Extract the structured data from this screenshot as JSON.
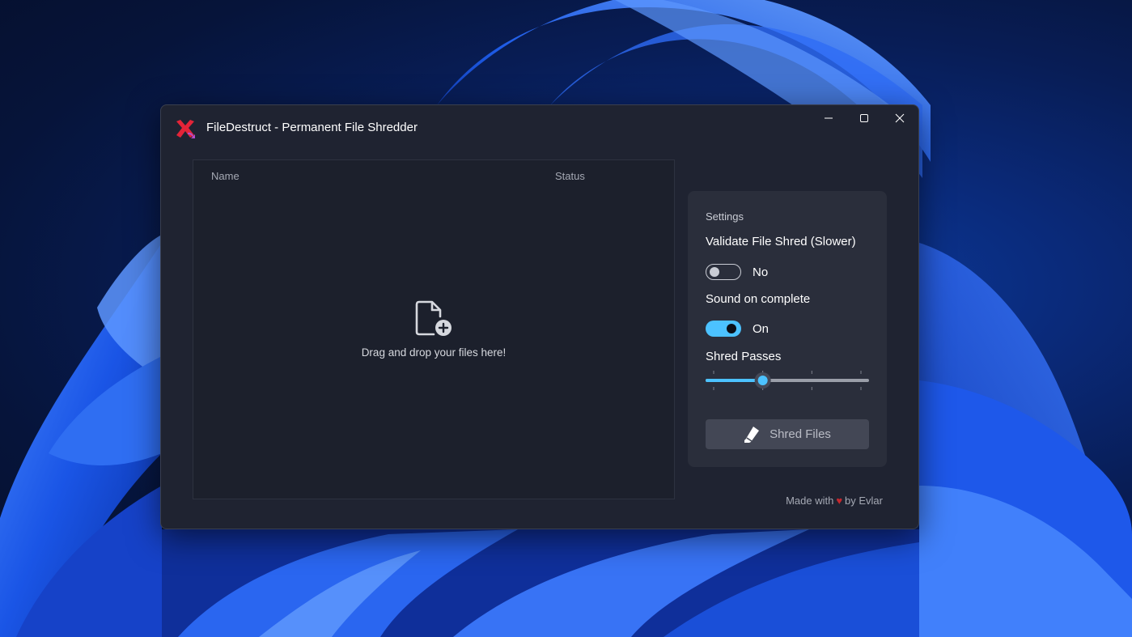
{
  "window": {
    "title": "FileDestruct - Permanent File Shredder",
    "app_icon": "x-mark-icon",
    "controls": [
      "minimize-icon",
      "maximize-icon",
      "close-icon"
    ]
  },
  "file_list": {
    "columns": [
      "Name",
      "Status"
    ],
    "empty_icon": "file-add-icon",
    "empty_text": "Drag and drop your files here!"
  },
  "settings": {
    "title": "Settings",
    "validate": {
      "label": "Validate File Shred (Slower)",
      "state": "No",
      "enabled": false
    },
    "sound": {
      "label": "Sound on complete",
      "state": "On",
      "enabled": true
    },
    "passes": {
      "label": "Shred Passes",
      "value": 2,
      "min": 1,
      "max": 4
    },
    "shred_button": {
      "label": "Shred Files",
      "icon": "eraser-icon"
    }
  },
  "footer": {
    "made_with": "Made with",
    "by": "by Evlar",
    "heart_icon": "heart-icon"
  },
  "colors": {
    "accent": "#4cc2ff",
    "heart": "#c4282e",
    "window_bg": "#1f2331",
    "card_bg": "#2a2e3b"
  }
}
